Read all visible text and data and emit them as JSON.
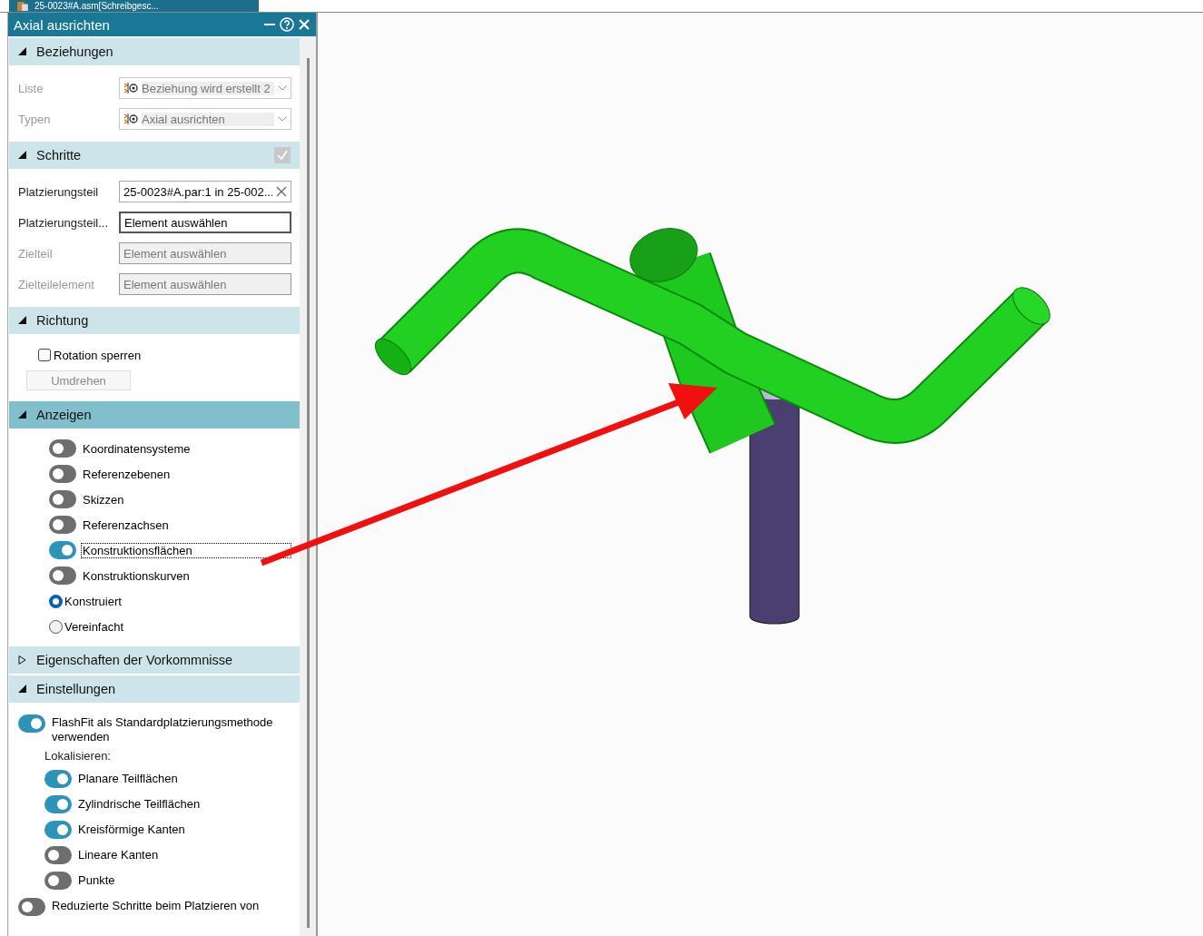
{
  "tab": {
    "title": "25-0023#A.asm[Schreibgesc..."
  },
  "panel": {
    "title": "Axial ausrichten",
    "sections": [
      {
        "title": "Beziehungen",
        "kind": "form",
        "expanded": true,
        "selected": false,
        "rows": [
          {
            "kind": "select",
            "label": "Liste",
            "value": "Beziehung wird erstellt 2",
            "disabled": true
          },
          {
            "kind": "select",
            "label": "Typen",
            "value": "Axial ausrichten",
            "disabled": true
          }
        ]
      },
      {
        "title": "Schritte",
        "kind": "form",
        "expanded": true,
        "selected": false,
        "step_check": {
          "checked": true
        },
        "rows": [
          {
            "kind": "input",
            "label": "Platzierungsteil",
            "value": "25-0023#A.par:1 in 25-002...",
            "disabled": false,
            "active": false,
            "clearable": true
          },
          {
            "kind": "input",
            "label": "Platzierungsteil...",
            "value": "Element auswählen",
            "disabled": false,
            "active": true,
            "clearable": false
          },
          {
            "kind": "input",
            "label": "Zielteil",
            "value": "Element auswählen",
            "disabled": true,
            "active": false,
            "clearable": false
          },
          {
            "kind": "input",
            "label": "Zielteilelement",
            "value": "Element auswählen",
            "disabled": true,
            "active": false,
            "clearable": false
          }
        ]
      },
      {
        "title": "Richtung",
        "kind": "form",
        "expanded": true,
        "selected": false,
        "rows": [
          {
            "kind": "checkbox",
            "label": "Rotation sperren",
            "checked": false
          },
          {
            "kind": "button",
            "label": "Umdrehen",
            "disabled": true
          }
        ]
      },
      {
        "title": "Anzeigen",
        "kind": "options",
        "expanded": true,
        "selected": true,
        "rows": [
          {
            "kind": "toggle",
            "label": "Koordinatensysteme",
            "on": false,
            "focused": false
          },
          {
            "kind": "toggle",
            "label": "Referenzebenen",
            "on": false,
            "focused": false
          },
          {
            "kind": "toggle",
            "label": "Skizzen",
            "on": false,
            "focused": false
          },
          {
            "kind": "toggle",
            "label": "Referenzachsen",
            "on": false,
            "focused": false
          },
          {
            "kind": "toggle",
            "label": "Konstruktionsflächen",
            "on": true,
            "focused": true
          },
          {
            "kind": "toggle",
            "label": "Konstruktionskurven",
            "on": false,
            "focused": false
          },
          {
            "kind": "radio",
            "label": "Konstruiert",
            "selected": true
          },
          {
            "kind": "radio",
            "label": "Vereinfacht",
            "selected": false
          }
        ]
      },
      {
        "title": "Eigenschaften der Vorkommnisse",
        "expanded": false,
        "selected": false
      },
      {
        "title": "Einstellungen",
        "kind": "settings",
        "expanded": true,
        "selected": false,
        "rows": [
          {
            "kind": "toggle",
            "label": "FlashFit als Standardplatzierungsmethode verwenden",
            "on": true,
            "focused": false
          },
          {
            "kind": "group",
            "label": "Lokalisieren:",
            "children": [
              {
                "kind": "toggle",
                "label": "Planare Teilflächen",
                "on": true,
                "focused": false
              },
              {
                "kind": "toggle",
                "label": "Zylindrische Teilflächen",
                "on": true,
                "focused": false
              },
              {
                "kind": "toggle",
                "label": "Kreisförmige Kanten",
                "on": true,
                "focused": false
              },
              {
                "kind": "toggle",
                "label": "Lineare Kanten",
                "on": false,
                "focused": false
              },
              {
                "kind": "toggle",
                "label": "Punkte",
                "on": false,
                "focused": false
              }
            ]
          },
          {
            "kind": "toggle",
            "label": "Reduzierte Schritte beim Platzieren von",
            "on": false,
            "focused": false
          }
        ]
      }
    ]
  }
}
